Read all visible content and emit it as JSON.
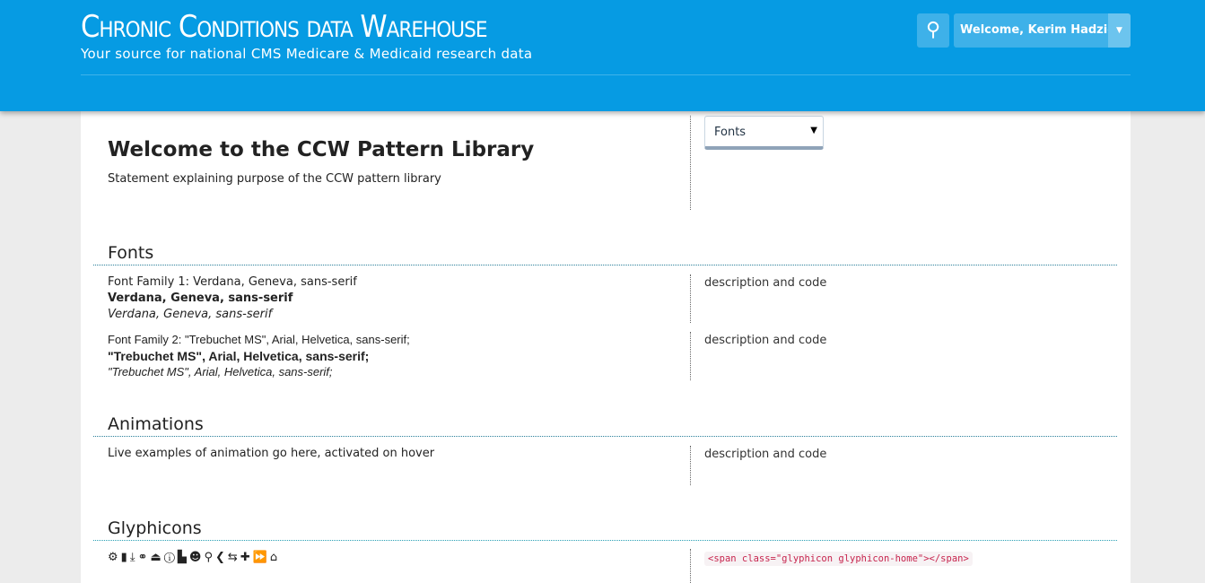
{
  "header": {
    "title": "Chronic Conditions data Warehouse",
    "subtitle": "Your source for national CMS Medicare & Medicaid research data",
    "user_label": "Welcome, Kerim Hadzic",
    "search_icon": "search-icon",
    "brand_color": "#069be3"
  },
  "intro": {
    "title": "Welcome to the CCW Pattern Library",
    "statement": "Statement explaining purpose of the CCW pattern library",
    "select_value": "Fonts"
  },
  "sections": {
    "fonts": {
      "heading": "Fonts",
      "family1": {
        "label": "Font Family 1: Verdana, Geneva, sans-serif",
        "bold": "Verdana, Geneva, sans-serif",
        "italic": "Verdana, Geneva, sans-serif",
        "desc": "description and code"
      },
      "family2": {
        "label": "Font Family 2: \"Trebuchet MS\", Arial, Helvetica, sans-serif;",
        "bold": "\"Trebuchet MS\", Arial, Helvetica, sans-serif;",
        "italic": "\"Trebuchet MS\", Arial, Helvetica, sans-serif;",
        "desc": "description and code"
      }
    },
    "animations": {
      "heading": "Animations",
      "text": "Live examples of animation go here, activated on hover",
      "desc": "description and code"
    },
    "glyphicons": {
      "heading": "Glyphicons",
      "icons": [
        "cog",
        "comment",
        "download-alt",
        "link",
        "hdd",
        "info-sign",
        "file",
        "user",
        "search",
        "chevron-left",
        "transfer",
        "plus",
        "forward",
        "home"
      ],
      "code": "<span class=\"glyphicon glyphicon-home\"></span>"
    }
  }
}
